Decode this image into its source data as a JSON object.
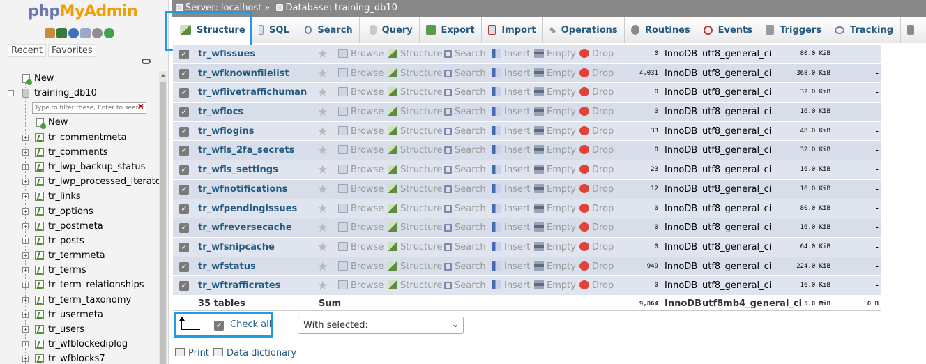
{
  "nav": {
    "logo_a": "php",
    "logo_b": "MyAdmin",
    "tabs": [
      "Recent",
      "Favorites"
    ],
    "new_label": "New",
    "database": "training_db10",
    "db_new_label": "New",
    "filter_placeholder": "Type to filter these, Enter to search",
    "filter_clear": "X",
    "tables": [
      "tr_commentmeta",
      "tr_comments",
      "tr_iwp_backup_status",
      "tr_iwp_processed_iterator",
      "tr_links",
      "tr_options",
      "tr_postmeta",
      "tr_posts",
      "tr_termmeta",
      "tr_terms",
      "tr_term_relationships",
      "tr_term_taxonomy",
      "tr_usermeta",
      "tr_users",
      "tr_wfblockediplog",
      "tr_wfblocks7"
    ]
  },
  "breadcrumb": {
    "server": "Server: localhost »",
    "database": "Database: training_db10"
  },
  "tabs": [
    "Structure",
    "SQL",
    "Search",
    "Query",
    "Export",
    "Import",
    "Operations",
    "Routines",
    "Events",
    "Triggers",
    "Tracking"
  ],
  "actions": [
    "Browse",
    "Structure",
    "Search",
    "Insert",
    "Empty",
    "Drop"
  ],
  "rows": [
    {
      "name": "tr_wfissues",
      "rows": "0",
      "engine": "InnoDB",
      "collation": "utf8_general_ci",
      "size": "80.0 KiB",
      "overhead": "-"
    },
    {
      "name": "tr_wfknownfilelist",
      "rows": "4,031",
      "engine": "InnoDB",
      "collation": "utf8_general_ci",
      "size": "368.0 KiB",
      "overhead": "-"
    },
    {
      "name": "tr_wflivetraffichuman",
      "rows": "0",
      "engine": "InnoDB",
      "collation": "utf8_general_ci",
      "size": "32.0 KiB",
      "overhead": "-"
    },
    {
      "name": "tr_wflocs",
      "rows": "0",
      "engine": "InnoDB",
      "collation": "utf8_general_ci",
      "size": "16.0 KiB",
      "overhead": "-"
    },
    {
      "name": "tr_wflogins",
      "rows": "33",
      "engine": "InnoDB",
      "collation": "utf8_general_ci",
      "size": "48.0 KiB",
      "overhead": "-"
    },
    {
      "name": "tr_wfls_2fa_secrets",
      "rows": "0",
      "engine": "InnoDB",
      "collation": "utf8_general_ci",
      "size": "32.0 KiB",
      "overhead": "-"
    },
    {
      "name": "tr_wfls_settings",
      "rows": "23",
      "engine": "InnoDB",
      "collation": "utf8_general_ci",
      "size": "16.0 KiB",
      "overhead": "-"
    },
    {
      "name": "tr_wfnotifications",
      "rows": "12",
      "engine": "InnoDB",
      "collation": "utf8_general_ci",
      "size": "16.0 KiB",
      "overhead": "-"
    },
    {
      "name": "tr_wfpendingissues",
      "rows": "0",
      "engine": "InnoDB",
      "collation": "utf8_general_ci",
      "size": "80.0 KiB",
      "overhead": "-"
    },
    {
      "name": "tr_wfreversecache",
      "rows": "0",
      "engine": "InnoDB",
      "collation": "utf8_general_ci",
      "size": "16.0 KiB",
      "overhead": "-"
    },
    {
      "name": "tr_wfsnipcache",
      "rows": "0",
      "engine": "InnoDB",
      "collation": "utf8_general_ci",
      "size": "64.0 KiB",
      "overhead": "-"
    },
    {
      "name": "tr_wfstatus",
      "rows": "949",
      "engine": "InnoDB",
      "collation": "utf8_general_ci",
      "size": "224.0 KiB",
      "overhead": "-"
    },
    {
      "name": "tr_wftrafficrates",
      "rows": "0",
      "engine": "InnoDB",
      "collation": "utf8_general_ci",
      "size": "16.0 KiB",
      "overhead": "-"
    }
  ],
  "summary": {
    "tables": "35 tables",
    "label": "Sum",
    "rows": "9,864",
    "engine": "InnoDB",
    "collation": "utf8mb4_general_ci",
    "size": "5.0 MiB",
    "overhead": "0 B"
  },
  "bulk": {
    "check_all": "Check all",
    "with_selected": "With selected:"
  },
  "footer": {
    "print": "Print",
    "data_dictionary": "Data dictionary"
  },
  "colors": {
    "link": "#235a81",
    "highlight": "#1e9be3",
    "row_bg": "#dfe4ee"
  }
}
